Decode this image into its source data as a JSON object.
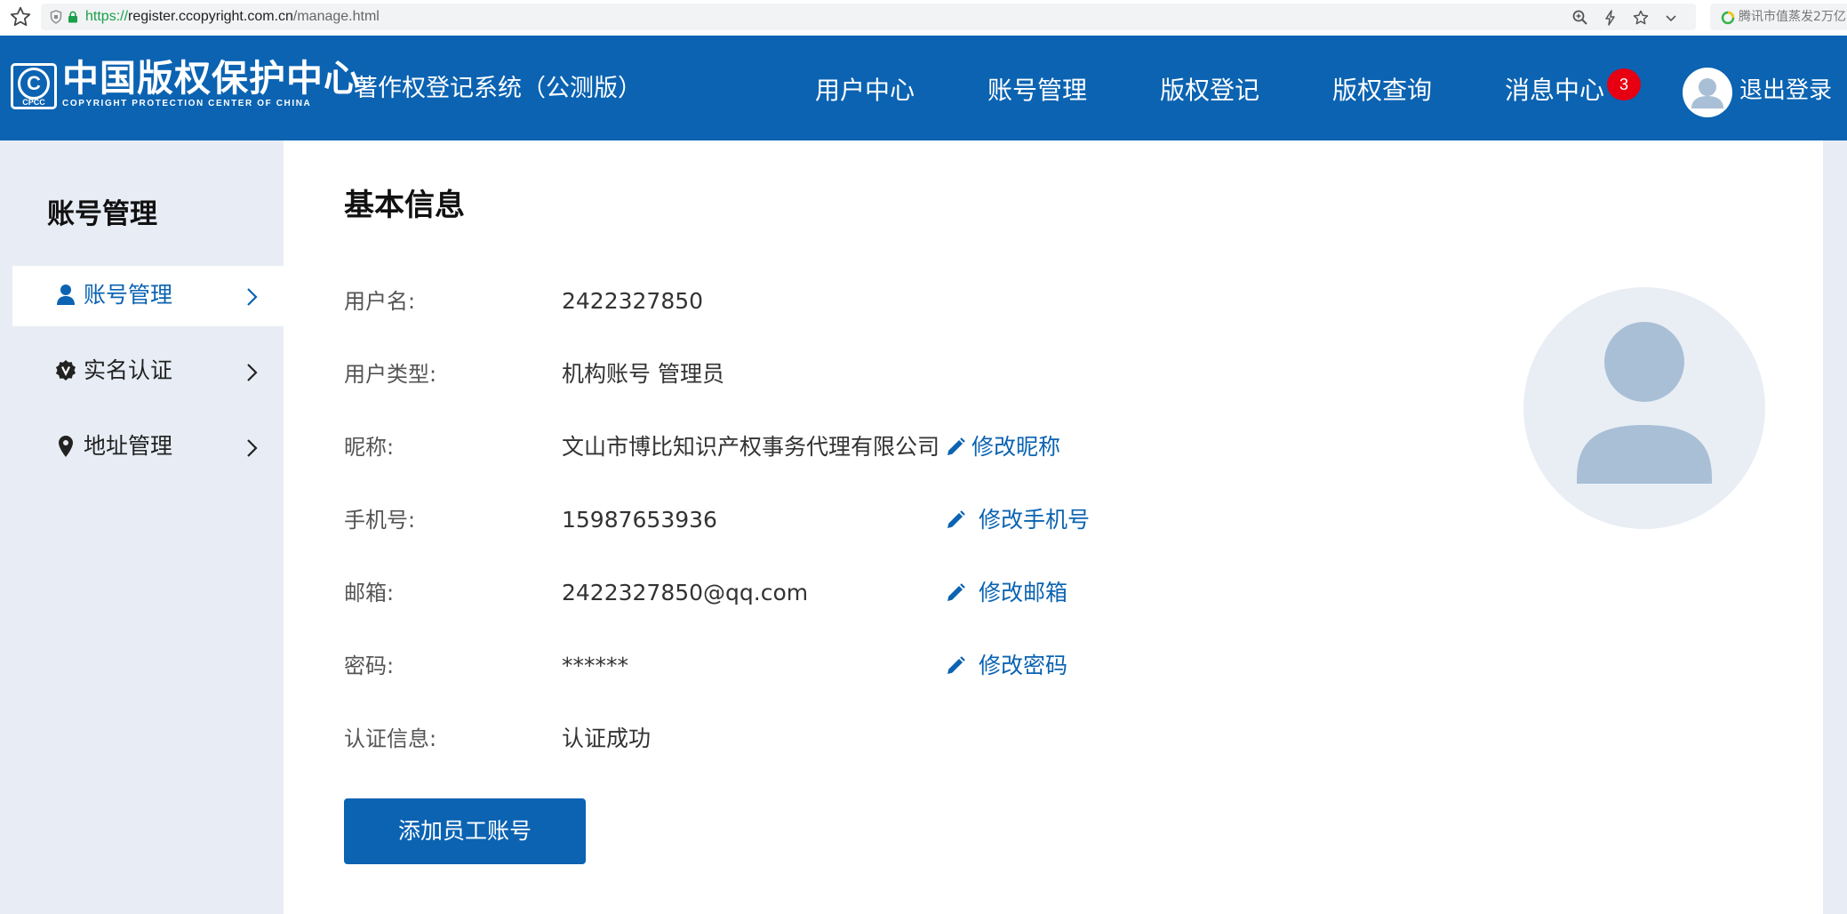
{
  "browser": {
    "url_protocol": "https://",
    "url_host": "register.ccopyright.com.cn",
    "url_path": "/manage.html",
    "news_text": "腾讯市值蒸发2万亿"
  },
  "header": {
    "logo_cn": "中国版权保护中心",
    "logo_en": "COPYRIGHT PROTECTION CENTER OF CHINA",
    "logo_mark_letter": "C",
    "logo_mark_abbr": "CPCC",
    "system_title": "著作权登记系统（公测版）",
    "nav": {
      "user_center": "用户中心",
      "account_manage": "账号管理",
      "copyright_register": "版权登记",
      "copyright_query": "版权查询",
      "message_center": "消息中心"
    },
    "message_count": "3",
    "logout": "退出登录"
  },
  "sidebar": {
    "title": "账号管理",
    "items": [
      {
        "label": "账号管理",
        "icon": "user-icon",
        "active": true
      },
      {
        "label": "实名认证",
        "icon": "verified-badge-icon",
        "active": false
      },
      {
        "label": "地址管理",
        "icon": "location-pin-icon",
        "active": false
      }
    ]
  },
  "main": {
    "title": "基本信息",
    "rows": {
      "username": {
        "label": "用户名:",
        "value": "2422327850"
      },
      "user_type": {
        "label": "用户类型:",
        "value": "机构账号 管理员"
      },
      "nickname": {
        "label": "昵称:",
        "value": "文山市博比知识产权事务代理有限公司",
        "action": "修改昵称"
      },
      "phone": {
        "label": "手机号:",
        "value": "15987653936",
        "action": "修改手机号"
      },
      "email": {
        "label": "邮箱:",
        "value": "2422327850@qq.com",
        "action": "修改邮箱"
      },
      "password": {
        "label": "密码:",
        "value": "******",
        "action": "修改密码"
      },
      "auth_info": {
        "label": "认证信息:",
        "value": "认证成功"
      }
    },
    "add_staff_button": "添加员工账号"
  },
  "colors": {
    "brand_blue": "#0b63b2",
    "badge_red": "#e60012",
    "sidebar_bg": "#e8edf5",
    "avatar_figure": "#a9bfd6"
  }
}
